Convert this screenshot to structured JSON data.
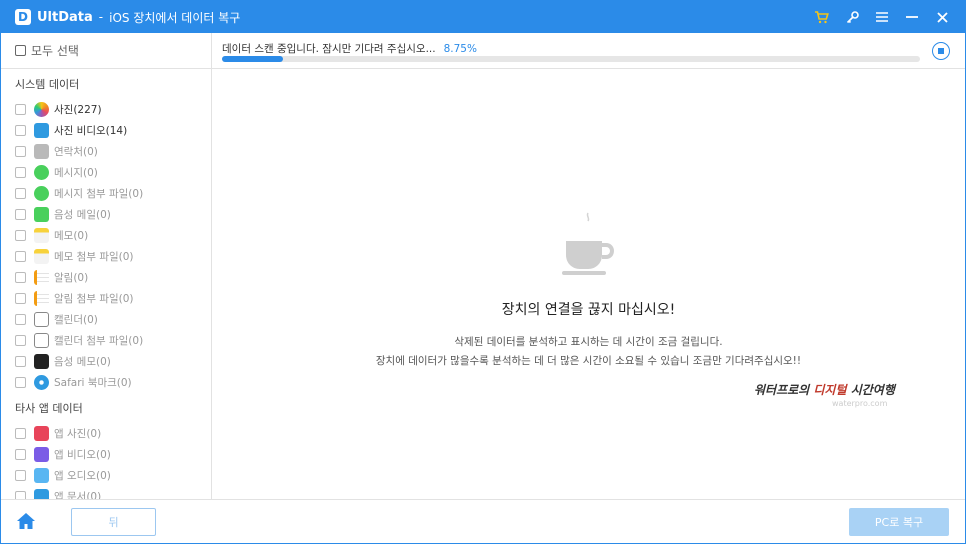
{
  "titlebar": {
    "logo_letter": "D",
    "app_name": "UltData",
    "separator": "-",
    "subtitle": "iOS 장치에서 데이터 복구",
    "icons": [
      "cart-icon",
      "key-icon",
      "menu-icon",
      "minimize-icon",
      "close-icon"
    ]
  },
  "sidebar": {
    "select_all_label": "모두 선택",
    "system_section_title": "시스템 데이터",
    "system_items": [
      {
        "label": "사진(227)",
        "icon": "photos-icon",
        "active": true
      },
      {
        "label": "사진 비디오(14)",
        "icon": "video-icon",
        "active": true
      },
      {
        "label": "연락처(0)",
        "icon": "contacts-icon",
        "active": false
      },
      {
        "label": "메시지(0)",
        "icon": "messages-icon",
        "active": false
      },
      {
        "label": "메시지 첨부 파일(0)",
        "icon": "message-attachment-icon",
        "active": false
      },
      {
        "label": "음성 메일(0)",
        "icon": "voicemail-icon",
        "active": false
      },
      {
        "label": "메모(0)",
        "icon": "notes-icon",
        "active": false
      },
      {
        "label": "메모 첨부 파일(0)",
        "icon": "notes-attachment-icon",
        "active": false
      },
      {
        "label": "알림(0)",
        "icon": "reminders-icon",
        "active": false
      },
      {
        "label": "알림 첨부 파일(0)",
        "icon": "reminders-attachment-icon",
        "active": false
      },
      {
        "label": "캘린더(0)",
        "icon": "calendar-icon",
        "active": false
      },
      {
        "label": "캘린더 첨부 파일(0)",
        "icon": "calendar-attachment-icon",
        "active": false
      },
      {
        "label": "음성 메모(0)",
        "icon": "voice-memo-icon",
        "active": false
      },
      {
        "label": "Safari 북마크(0)",
        "icon": "safari-icon",
        "active": false
      }
    ],
    "thirdparty_section_title": "타사 앱 데이터",
    "thirdparty_items": [
      {
        "label": "앱 사진(0)",
        "icon": "app-photos-icon",
        "active": false
      },
      {
        "label": "앱 비디오(0)",
        "icon": "app-video-icon",
        "active": false
      },
      {
        "label": "앱 오디오(0)",
        "icon": "app-audio-icon",
        "active": false
      },
      {
        "label": "앱 문서(0)",
        "icon": "app-docs-icon",
        "active": false
      }
    ]
  },
  "scan": {
    "status_text": "데이터 스캔 중입니다. 잠시만 기다려 주십시오...",
    "percent_text": "8.75%",
    "progress_fraction": 0.0875
  },
  "main": {
    "warning_title": "장치의 연결을 끊지 마십시오!",
    "warning_line1": "삭제된 데이터를 분석하고 표시하는 데 시간이 조금 걸립니다.",
    "warning_line2": "장치에 데이터가 많을수록 분석하는 데 더 많은 시간이 소요될 수 있습니 조금만 기다려주십시오!!",
    "watermark_prefix": "워터프로의 ",
    "watermark_highlight": "디지털",
    "watermark_suffix": " 시간여행",
    "watermark_sub": "waterpro.com"
  },
  "footer": {
    "back_label": "뒤",
    "recover_label": "PC로 복구"
  },
  "colors": {
    "accent": "#2b8be8",
    "cart": "#f5c518"
  }
}
